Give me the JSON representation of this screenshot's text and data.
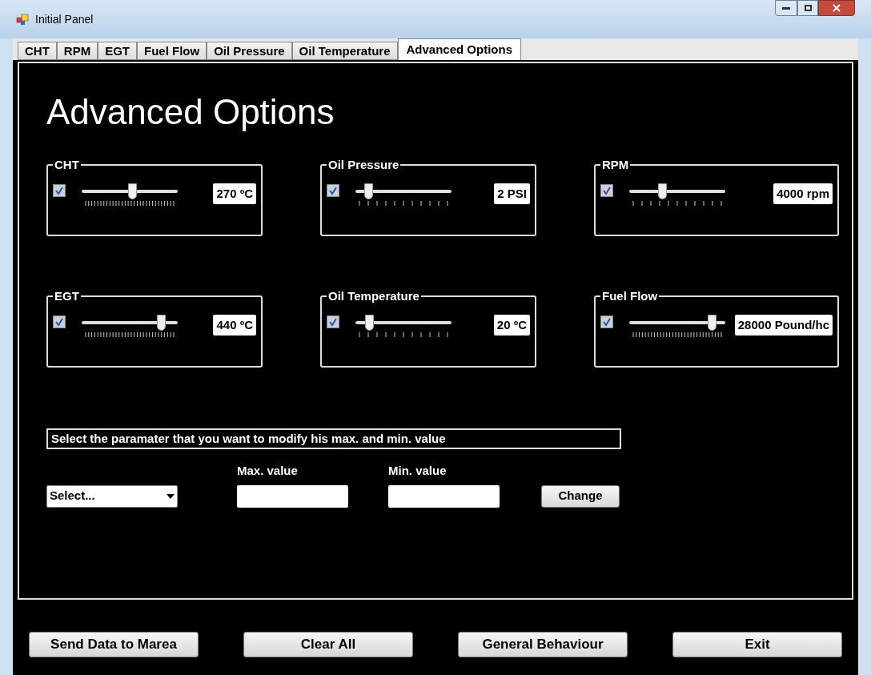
{
  "window": {
    "title": "Initial Panel"
  },
  "tabs": [
    {
      "label": "CHT",
      "selected": false
    },
    {
      "label": "RPM",
      "selected": false
    },
    {
      "label": "EGT",
      "selected": false
    },
    {
      "label": "Fuel Flow",
      "selected": false
    },
    {
      "label": "Oil Pressure",
      "selected": false
    },
    {
      "label": "Oil Temperature",
      "selected": false
    },
    {
      "label": "Advanced Options",
      "selected": true
    }
  ],
  "heading": "Advanced Options",
  "groups": [
    {
      "title": "CHT",
      "checked": true,
      "level": 0.53,
      "kind": "dense",
      "value": "270 ºC"
    },
    {
      "title": "Oil Pressure",
      "checked": true,
      "level": 0.14,
      "kind": "sparse",
      "value": "2 PSI"
    },
    {
      "title": "RPM",
      "checked": true,
      "level": 0.35,
      "kind": "sparse",
      "value": "4000 rpm"
    },
    {
      "title": "EGT",
      "checked": true,
      "level": 0.83,
      "kind": "dense",
      "value": "440 ºC"
    },
    {
      "title": "Oil Temperature",
      "checked": true,
      "level": 0.15,
      "kind": "sparse",
      "value": "20 ºC"
    },
    {
      "title": "Fuel Flow",
      "checked": true,
      "level": 0.87,
      "kind": "dense",
      "value": "28000 Pound/hc"
    }
  ],
  "instruction": "Select the paramater that you want to modify his max. and min. value",
  "select": {
    "value": "Select..."
  },
  "max_field": {
    "label": "Max. value"
  },
  "min_field": {
    "label": "Min. value"
  },
  "change_button": "Change",
  "buttons": [
    "Send Data to Marea",
    "Clear All",
    "General Behaviour",
    "Exit"
  ]
}
